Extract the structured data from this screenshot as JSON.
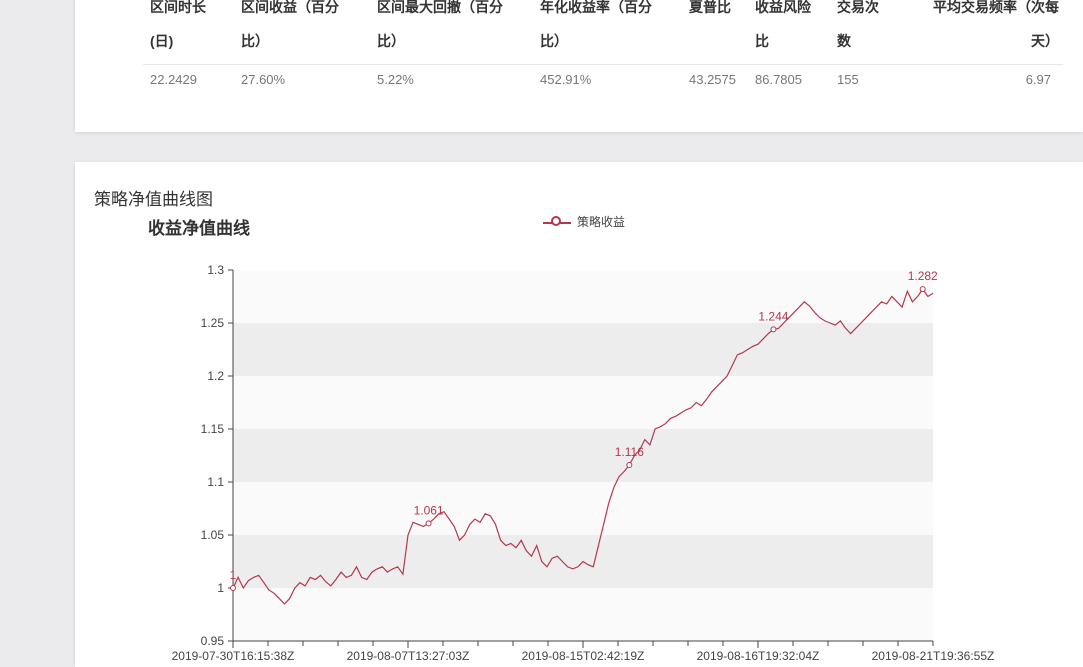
{
  "stats_table": {
    "headers": [
      "区间时长(日)",
      "区间收益（百分比）",
      "区间最大回撤（百分比）",
      "年化收益率（百分比）",
      "夏普比",
      "收益风险比",
      "交易次数",
      "平均交易频率（次每天）"
    ],
    "values": [
      "22.2429",
      "27.60%",
      "5.22%",
      "452.91%",
      "43.2575",
      "86.7805",
      "155",
      "6.97"
    ]
  },
  "chart_section": {
    "section_title": "策略净值曲线图"
  },
  "colors": {
    "series_line": "#b6374d",
    "band_dark": "#ededed",
    "band_light": "#fafafa"
  },
  "chart_data": {
    "type": "line",
    "title": "收益净值曲线",
    "xlabel": "",
    "ylabel": "",
    "ylim": [
      0.95,
      1.3
    ],
    "yticks": [
      0.95,
      1,
      1.05,
      1.1,
      1.15,
      1.2,
      1.25,
      1.3
    ],
    "ytick_labels": [
      "0.95",
      "1",
      "1.05",
      "1.1",
      "1.15",
      "1.2",
      "1.25",
      "1.3"
    ],
    "xtick_labels": [
      "2019-07-30T16:15:38Z",
      "2019-08-07T13:27:03Z",
      "2019-08-15T02:42:19Z",
      "2019-08-16T19:32:04Z",
      "2019-08-21T19:36:55Z"
    ],
    "grid": "horizontal-bands",
    "legend_position": "top-center",
    "series": [
      {
        "name": "策略收益",
        "values": [
          1.0,
          1.01,
          1.0,
          1.007,
          1.01,
          1.012,
          1.005,
          0.998,
          0.995,
          0.99,
          0.985,
          0.99,
          1.0,
          1.005,
          1.002,
          1.01,
          1.008,
          1.012,
          1.006,
          1.002,
          1.008,
          1.015,
          1.01,
          1.012,
          1.02,
          1.01,
          1.008,
          1.015,
          1.018,
          1.02,
          1.015,
          1.018,
          1.02,
          1.013,
          1.05,
          1.062,
          1.06,
          1.058,
          1.061,
          1.065,
          1.07,
          1.072,
          1.065,
          1.058,
          1.045,
          1.05,
          1.06,
          1.065,
          1.062,
          1.07,
          1.068,
          1.06,
          1.045,
          1.04,
          1.042,
          1.038,
          1.045,
          1.035,
          1.03,
          1.04,
          1.025,
          1.02,
          1.028,
          1.03,
          1.025,
          1.02,
          1.018,
          1.02,
          1.025,
          1.022,
          1.02,
          1.04,
          1.06,
          1.08,
          1.095,
          1.105,
          1.11,
          1.116,
          1.125,
          1.13,
          1.14,
          1.135,
          1.15,
          1.152,
          1.155,
          1.16,
          1.162,
          1.165,
          1.168,
          1.17,
          1.175,
          1.172,
          1.178,
          1.185,
          1.19,
          1.195,
          1.2,
          1.21,
          1.22,
          1.222,
          1.225,
          1.228,
          1.23,
          1.235,
          1.24,
          1.244,
          1.245,
          1.25,
          1.255,
          1.26,
          1.265,
          1.27,
          1.266,
          1.26,
          1.255,
          1.252,
          1.25,
          1.248,
          1.252,
          1.245,
          1.24,
          1.245,
          1.25,
          1.255,
          1.26,
          1.265,
          1.27,
          1.268,
          1.275,
          1.27,
          1.265,
          1.28,
          1.27,
          1.275,
          1.282,
          1.275,
          1.278
        ]
      }
    ],
    "annotations": [
      {
        "index": 0,
        "label": "1"
      },
      {
        "index": 38,
        "label": "1.061"
      },
      {
        "index": 77,
        "label": "1.116"
      },
      {
        "index": 105,
        "label": "1.244"
      },
      {
        "index": 134,
        "label": "1.282"
      }
    ]
  }
}
